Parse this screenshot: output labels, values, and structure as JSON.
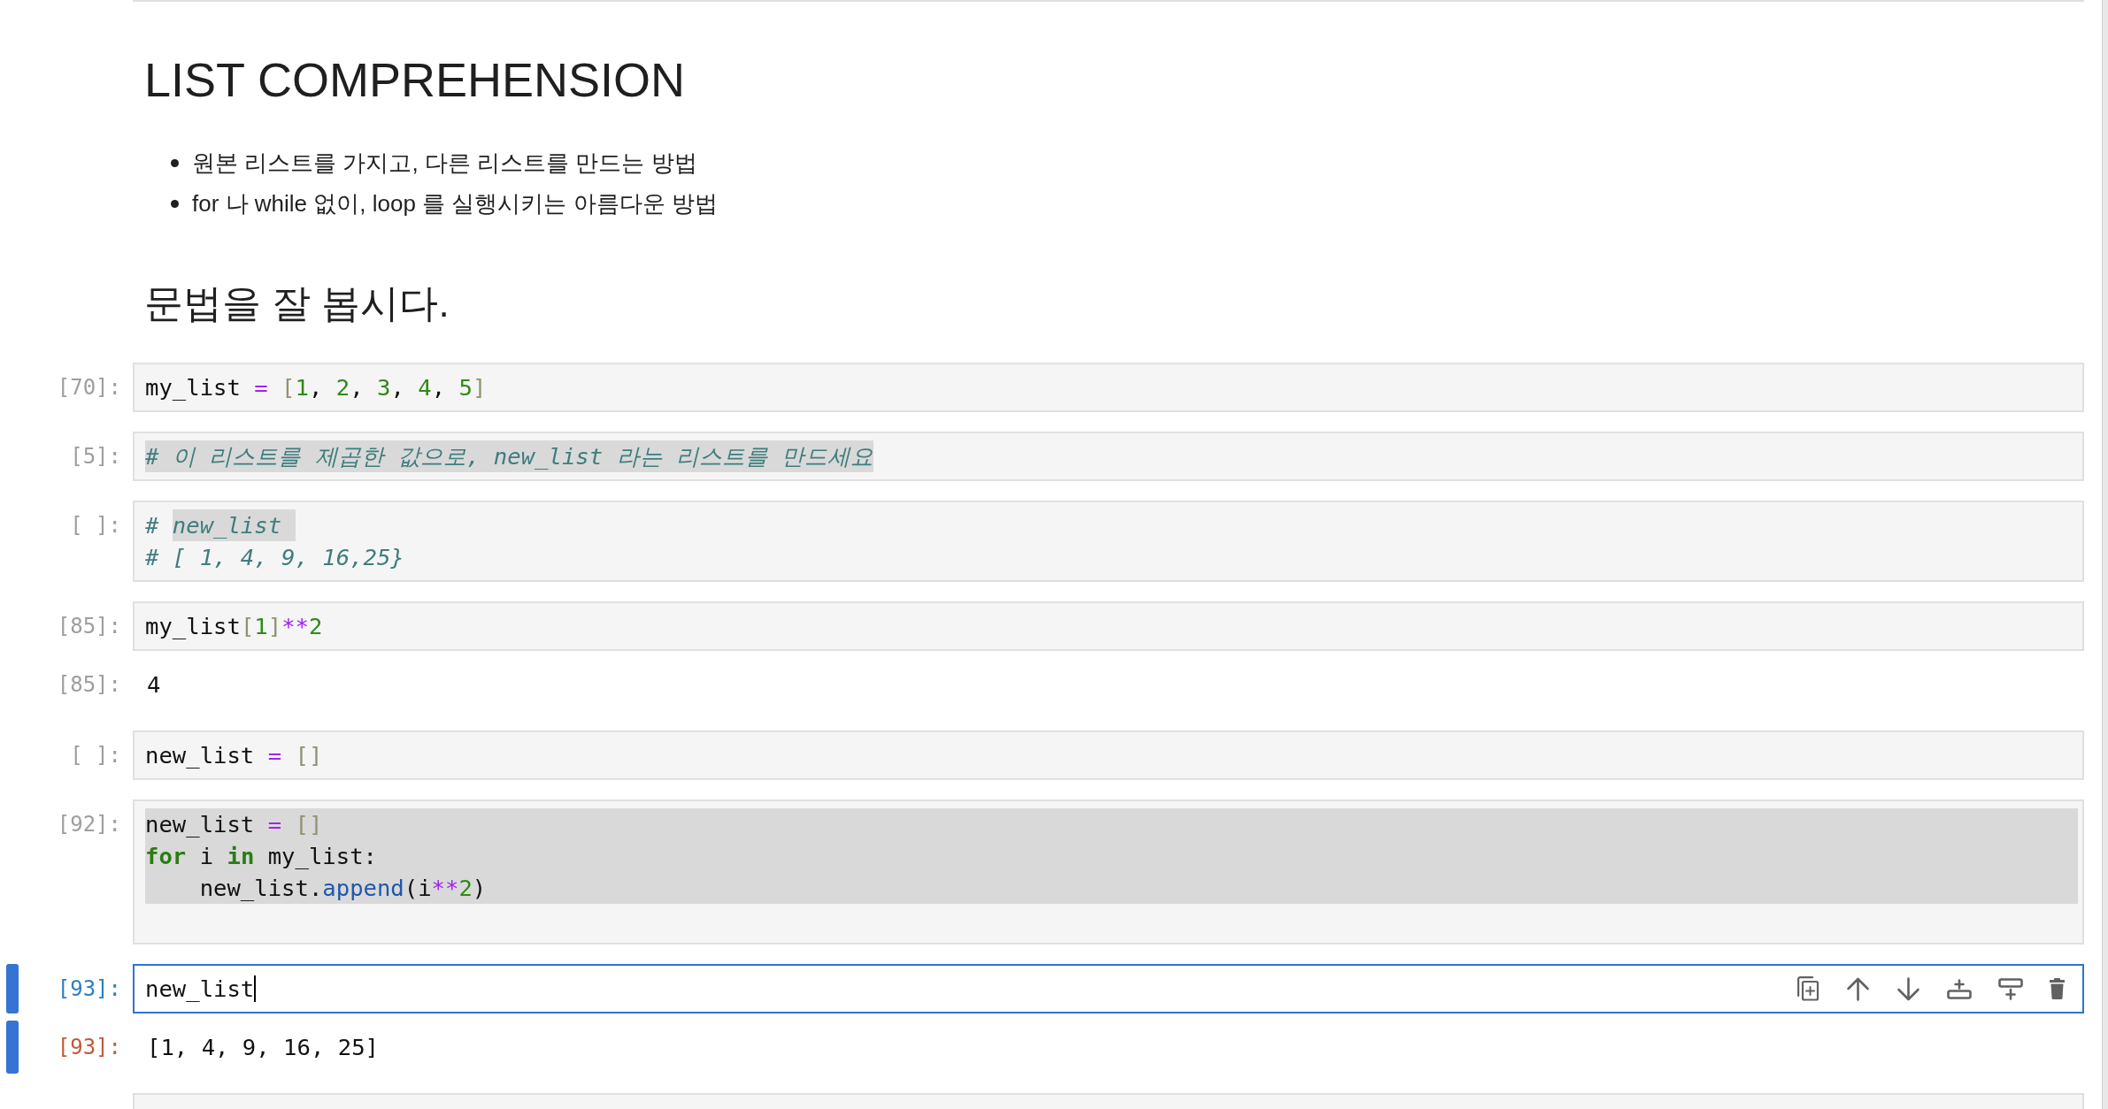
{
  "markdown": {
    "heading": "LIST COMPREHENSION",
    "bullets": [
      "원본 리스트를 가지고, 다른 리스트를 만드는 방법",
      "for 나 while 없이, loop 를 실행시키는 아름다운 방법"
    ],
    "subheading": "문법을 잘 봅시다."
  },
  "cells": [
    {
      "prompt": "[70]:",
      "active": false,
      "lines": [
        {
          "kind": "code",
          "segments": [
            {
              "highlighted": false,
              "tokens": [
                {
                  "text": "my_list ",
                  "kind": "name"
                },
                {
                  "text": "= ",
                  "kind": "operator"
                },
                {
                  "text": "[",
                  "kind": "bracket"
                },
                {
                  "text": "1",
                  "kind": "number"
                },
                {
                  "text": ", ",
                  "kind": "punctuation"
                },
                {
                  "text": "2",
                  "kind": "number"
                },
                {
                  "text": ", ",
                  "kind": "punctuation"
                },
                {
                  "text": "3",
                  "kind": "number"
                },
                {
                  "text": ", ",
                  "kind": "punctuation"
                },
                {
                  "text": "4",
                  "kind": "number"
                },
                {
                  "text": ", ",
                  "kind": "punctuation"
                },
                {
                  "text": "5",
                  "kind": "number"
                },
                {
                  "text": "]",
                  "kind": "bracket"
                }
              ]
            }
          ]
        }
      ]
    },
    {
      "prompt": "[5]:",
      "active": false,
      "lines": [
        {
          "kind": "code",
          "segments": [
            {
              "highlighted": true,
              "tokens": [
                {
                  "text": "# 이 리스트를 제곱한 값으로, new_list 라는 리스트를 만드세요",
                  "kind": "comment"
                }
              ]
            }
          ]
        }
      ]
    },
    {
      "prompt": "[ ]:",
      "active": false,
      "lines": [
        {
          "kind": "code",
          "segments": [
            {
              "highlighted": false,
              "tokens": [
                {
                  "text": "# ",
                  "kind": "comment"
                }
              ]
            },
            {
              "highlighted": true,
              "tokens": [
                {
                  "text": "new_list ",
                  "kind": "comment"
                }
              ]
            }
          ]
        },
        {
          "kind": "code",
          "segments": [
            {
              "highlighted": false,
              "tokens": [
                {
                  "text": "# [ 1, 4, 9, 16,25}",
                  "kind": "comment"
                }
              ]
            }
          ]
        }
      ]
    },
    {
      "prompt": "[85]:",
      "active": false,
      "lines": [
        {
          "kind": "code",
          "segments": [
            {
              "highlighted": false,
              "tokens": [
                {
                  "text": "my_list",
                  "kind": "name"
                },
                {
                  "text": "[",
                  "kind": "bracket"
                },
                {
                  "text": "1",
                  "kind": "number"
                },
                {
                  "text": "]",
                  "kind": "bracket"
                },
                {
                  "text": "**",
                  "kind": "operator"
                },
                {
                  "text": "2",
                  "kind": "number"
                }
              ]
            }
          ]
        }
      ],
      "output": {
        "prompt": "[85]:",
        "text": "4"
      }
    },
    {
      "prompt": "[ ]:",
      "active": false,
      "lines": [
        {
          "kind": "code",
          "segments": [
            {
              "highlighted": false,
              "tokens": [
                {
                  "text": "new_list ",
                  "kind": "name"
                },
                {
                  "text": "= ",
                  "kind": "operator"
                },
                {
                  "text": "[]",
                  "kind": "bracket"
                }
              ]
            }
          ]
        }
      ]
    },
    {
      "prompt": "[92]:",
      "active": false,
      "lines": [
        {
          "kind": "selected",
          "tokens": [
            {
              "text": "new_list ",
              "kind": "name"
            },
            {
              "text": "= ",
              "kind": "operator"
            },
            {
              "text": "[]",
              "kind": "bracket"
            }
          ]
        },
        {
          "kind": "selected",
          "tokens": [
            {
              "text": "for",
              "kind": "keyword"
            },
            {
              "text": " i ",
              "kind": "name"
            },
            {
              "text": "in",
              "kind": "keyword"
            },
            {
              "text": " my_list:",
              "kind": "name"
            }
          ]
        },
        {
          "kind": "selected",
          "tokens": [
            {
              "text": "    new_list.",
              "kind": "name"
            },
            {
              "text": "append",
              "kind": "property"
            },
            {
              "text": "(i",
              "kind": "name"
            },
            {
              "text": "**",
              "kind": "operator"
            },
            {
              "text": "2",
              "kind": "number"
            },
            {
              "text": ")",
              "kind": "punctuation"
            }
          ]
        },
        {
          "kind": "blank"
        }
      ]
    },
    {
      "prompt": "[93]:",
      "active": true,
      "lines": [
        {
          "kind": "code",
          "segments": [
            {
              "highlighted": false,
              "tokens": [
                {
                  "text": "new_list",
                  "kind": "name"
                }
              ]
            }
          ]
        }
      ],
      "output": {
        "prompt": "[93]:",
        "text": "[1, 4, 9, 16, 25]"
      }
    },
    {
      "active": false
    }
  ]
}
